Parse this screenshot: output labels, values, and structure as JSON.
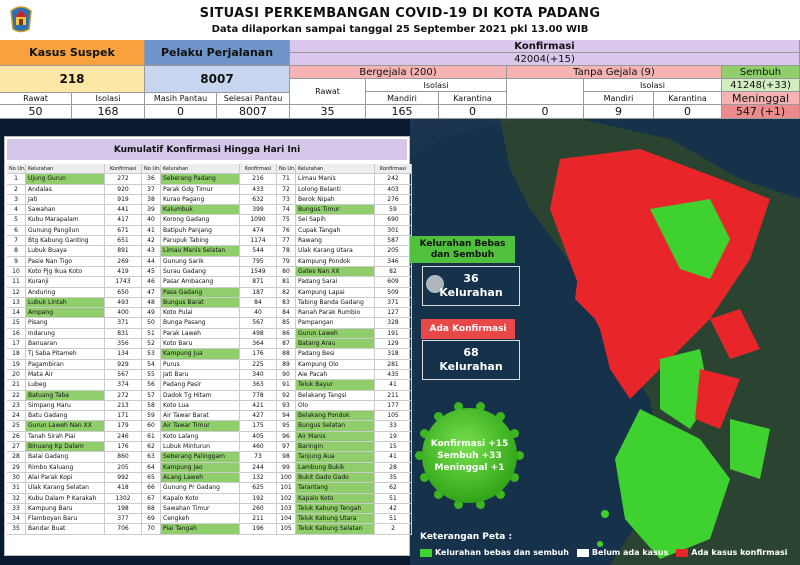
{
  "header": {
    "title": "SITUASI PERKEMBANGAN COVID-19 DI KOTA PADANG",
    "subtitle": "Data dilaporkan sampai tanggal 25 September 2021 pkl 13.00 WIB",
    "logo_icon": "city-emblem-icon"
  },
  "stats": {
    "kasus_suspek": {
      "label": "Kasus Suspek",
      "total": "218",
      "rawat_label": "Rawat",
      "isolasi_label": "Isolasi",
      "rawat": "50",
      "isolasi": "168"
    },
    "pelaku_perjalanan": {
      "label": "Pelaku Perjalanan",
      "total": "8007",
      "masih_pantau_label": "Masih Pantau",
      "selesai_pantau_label": "Selesai Pantau",
      "masih_pantau": "0",
      "selesai_pantau": "8007"
    },
    "konfirmasi": {
      "label": "Konfirmasi",
      "total": "42004(+15)",
      "bergejala": {
        "label": "Bergejala (200)",
        "rawat_label": "Rawat",
        "isolasi_label": "Isolasi",
        "mandiri_label": "Mandiri",
        "karantina_label": "Karantina",
        "rawat": "35",
        "mandiri": "165",
        "karantina": "0"
      },
      "tanpa_gejala": {
        "label": "Tanpa Gejala (9)",
        "isolasi_label": "Isolasi",
        "mandiri_label": "Mandiri",
        "karantina_label": "Karantina",
        "rawat": "0",
        "mandiri": "9",
        "karantina": "0"
      },
      "sembuh_label": "Sembuh",
      "sembuh": "41248(+33)",
      "meninggal_label": "Meninggal",
      "meninggal": "547 (+1)"
    }
  },
  "table": {
    "title": "Kumulatif Konfirmasi Hingga Hari Ini",
    "col_no": "No Urut",
    "col_kelurahan": "Kelurahan",
    "col_konfirmasi": "Konfirmasi",
    "columns": [
      [
        [
          "1",
          "Ujung Gurun",
          "272",
          true
        ],
        [
          "2",
          "Andalas",
          "920",
          false
        ],
        [
          "3",
          "Jati",
          "919",
          false
        ],
        [
          "4",
          "Sawahan",
          "441",
          false
        ],
        [
          "5",
          "Kubu Marapalam",
          "417",
          false
        ],
        [
          "6",
          "Gunung Pangilun",
          "671",
          false
        ],
        [
          "7",
          "Btg Kabung Ganting",
          "651",
          false
        ],
        [
          "8",
          "Lubuk Buaya",
          "891",
          false
        ],
        [
          "9",
          "Pasie Nan Tigo",
          "269",
          false
        ],
        [
          "10",
          "Koto Pjg Ikua Koto",
          "419",
          false
        ],
        [
          "11",
          "Kuranji",
          "1743",
          false
        ],
        [
          "12",
          "Anduring",
          "650",
          false
        ],
        [
          "13",
          "Lubuk Lintah",
          "493",
          true
        ],
        [
          "14",
          "Ampang",
          "400",
          true
        ],
        [
          "15",
          "Pisang",
          "371",
          false
        ],
        [
          "16",
          "Indarung",
          "831",
          false
        ],
        [
          "17",
          "Banuaran",
          "356",
          false
        ],
        [
          "18",
          "Tj Saba Pitameh",
          "134",
          false
        ],
        [
          "19",
          "Pagambiran",
          "929",
          false
        ],
        [
          "20",
          "Mata Air",
          "567",
          false
        ],
        [
          "21",
          "Lubeg",
          "374",
          false
        ],
        [
          "22",
          "Batuang Taba",
          "272",
          true
        ],
        [
          "23",
          "Simpang Haru",
          "213",
          false
        ],
        [
          "24",
          "Batu Gadang",
          "171",
          false
        ],
        [
          "25",
          "Gurun Laweh Nan XX",
          "179",
          true
        ],
        [
          "26",
          "Tanah Sirah Piai",
          "246",
          false
        ],
        [
          "27",
          "Binuang Kp Dalam",
          "176",
          true
        ],
        [
          "28",
          "Balai Gadang",
          "860",
          false
        ],
        [
          "29",
          "Rimbo Kaluang",
          "205",
          false
        ],
        [
          "30",
          "Alai Parak Kopi",
          "992",
          false
        ],
        [
          "31",
          "Ulak Karang Selatan",
          "418",
          false
        ],
        [
          "32",
          "Kubu Dalam P Karakah",
          "1302",
          false
        ],
        [
          "33",
          "Kampung Baru",
          "198",
          false
        ],
        [
          "34",
          "Flamboyan Baru",
          "377",
          false
        ],
        [
          "35",
          "Bandar Buat",
          "706",
          false
        ]
      ],
      [
        [
          "36",
          "Seberang Padang",
          "216",
          true
        ],
        [
          "37",
          "Parak Gdg Timur",
          "433",
          false
        ],
        [
          "38",
          "Kurao Pagang",
          "632",
          false
        ],
        [
          "39",
          "Kalumbuk",
          "399",
          true
        ],
        [
          "40",
          "Korong Gadang",
          "1090",
          false
        ],
        [
          "41",
          "Batipuh Panjang",
          "474",
          false
        ],
        [
          "42",
          "Parupuk Tabing",
          "1174",
          false
        ],
        [
          "43",
          "Limau Manis Selatan",
          "544",
          true
        ],
        [
          "44",
          "Gunung Sarik",
          "795",
          false
        ],
        [
          "45",
          "Surau Gadang",
          "1549",
          false
        ],
        [
          "46",
          "Pasar Ambacang",
          "871",
          false
        ],
        [
          "47",
          "Pasa Gadang",
          "187",
          true
        ],
        [
          "48",
          "Bungus Barat",
          "84",
          true
        ],
        [
          "49",
          "Koto Pulai",
          "40",
          false
        ],
        [
          "50",
          "Bunga Pasang",
          "567",
          false
        ],
        [
          "51",
          "Parak Laweh",
          "498",
          false
        ],
        [
          "52",
          "Koto Baru",
          "364",
          false
        ],
        [
          "53",
          "Kampung Jua",
          "176",
          true
        ],
        [
          "54",
          "Purus",
          "225",
          false
        ],
        [
          "55",
          "Jati Baru",
          "340",
          false
        ],
        [
          "56",
          "Padang Pasir",
          "363",
          false
        ],
        [
          "57",
          "Dadok Tg Hitam",
          "778",
          false
        ],
        [
          "58",
          "Koto Lua",
          "421",
          false
        ],
        [
          "59",
          "Air Tawar Barat",
          "427",
          false
        ],
        [
          "60",
          "Air Tawar Timur",
          "175",
          true
        ],
        [
          "61",
          "Koto Lalang",
          "405",
          false
        ],
        [
          "62",
          "Lubuk Minturun",
          "460",
          false
        ],
        [
          "63",
          "Seberang Palinggam",
          "73",
          true
        ],
        [
          "64",
          "Kampung Jao",
          "244",
          true
        ],
        [
          "65",
          "ALang Laweh",
          "132",
          true
        ],
        [
          "66",
          "Gunung Pr Gadang",
          "625",
          false
        ],
        [
          "67",
          "Kapalo Koto",
          "192",
          false
        ],
        [
          "68",
          "Sawahan Timur",
          "260",
          false
        ],
        [
          "69",
          "Cengkeh",
          "211",
          false
        ],
        [
          "70",
          "Piai Tangah",
          "196",
          true
        ]
      ],
      [
        [
          "71",
          "Limau Manis",
          "242",
          false
        ],
        [
          "72",
          "Lolong Belanti",
          "403",
          false
        ],
        [
          "73",
          "Berok Nipah",
          "276",
          false
        ],
        [
          "74",
          "Bungus Timur",
          "59",
          true
        ],
        [
          "75",
          "Sei Sapih",
          "690",
          false
        ],
        [
          "76",
          "Cupak Tangah",
          "301",
          false
        ],
        [
          "77",
          "Rawang",
          "587",
          false
        ],
        [
          "78",
          "Ulak Karang Utara",
          "205",
          false
        ],
        [
          "79",
          "Kampung Pondok",
          "346",
          false
        ],
        [
          "80",
          "Gates Nan XX",
          "82",
          true
        ],
        [
          "81",
          "Padang Sarai",
          "609",
          false
        ],
        [
          "82",
          "Kampung Lapai",
          "509",
          false
        ],
        [
          "83",
          "Tabing Banda Gadang",
          "371",
          false
        ],
        [
          "84",
          "Ranah Parak Rumbio",
          "127",
          false
        ],
        [
          "85",
          "Pampangan",
          "328",
          false
        ],
        [
          "86",
          "Gurun Laweh",
          "191",
          true
        ],
        [
          "87",
          "Batang Arau",
          "129",
          true
        ],
        [
          "88",
          "Padang Besi",
          "318",
          false
        ],
        [
          "89",
          "Kampung Olo",
          "281",
          false
        ],
        [
          "90",
          "Aie Pacah",
          "435",
          false
        ],
        [
          "91",
          "Teluk Bayur",
          "41",
          true
        ],
        [
          "92",
          "Belakang Tangsi",
          "211",
          false
        ],
        [
          "93",
          "Olo",
          "177",
          false
        ],
        [
          "94",
          "Belakang Pondok",
          "105",
          true
        ],
        [
          "95",
          "Bungus Selatan",
          "33",
          true
        ],
        [
          "96",
          "Air Manis",
          "19",
          true
        ],
        [
          "97",
          "Baringin",
          "15",
          true
        ],
        [
          "98",
          "Tanjung Aua",
          "41",
          true
        ],
        [
          "99",
          "Lambung Bukik",
          "28",
          true
        ],
        [
          "100",
          "Bukit Gado Gado",
          "35",
          true
        ],
        [
          "101",
          "Tarantang",
          "62",
          true
        ],
        [
          "102",
          "Kapalo Koto",
          "51",
          true
        ],
        [
          "103",
          "Teluk Kabung Tengah",
          "42",
          true
        ],
        [
          "104",
          "Teluk Kabung Utara",
          "51",
          true
        ],
        [
          "105",
          "Teluk Kabung Selatan",
          "2",
          true
        ]
      ]
    ]
  },
  "overlay": {
    "bebas_label": "Kelurahan Bebas dan Sembuh",
    "bebas_count": "36",
    "bebas_unit": "Kelurahan",
    "konfirmasi_label": "Ada Konfirmasi",
    "konfirmasi_count": "68",
    "konfirmasi_unit": "Kelurahan",
    "virus_line1": "Konfirmasi +15",
    "virus_line2": "Sembuh +33",
    "virus_line3": "Meninggal +1"
  },
  "legend": {
    "title": "Keterangan Peta :",
    "items": [
      {
        "label": "Kelurahan bebas dan sembuh",
        "color": "#3fd12f"
      },
      {
        "label": "Belum ada kasus",
        "color": "#ffffff"
      },
      {
        "label": "Ada kasus konfirmasi",
        "color": "#e8262a"
      }
    ]
  },
  "colors": {
    "green": "#8fce6a",
    "red": "#e8262a",
    "map_green": "#3fd12f"
  }
}
